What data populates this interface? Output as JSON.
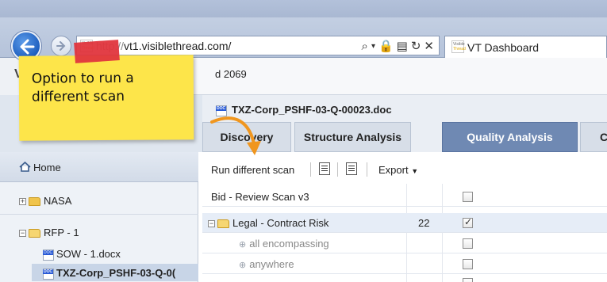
{
  "browser": {
    "url": "http://vt1.visiblethread.com/",
    "url_visible": "vt1.visiblethread.com/",
    "tab_title": "VT Dashboard",
    "favicon_text": [
      "Visible",
      "Thread"
    ]
  },
  "app": {
    "id_text": "d 2069",
    "brand_letter": "V"
  },
  "document": {
    "title": "TXZ-Corp_PSHF-03-Q-00023.doc"
  },
  "analysis_tabs": [
    {
      "label": "Discovery"
    },
    {
      "label": "Structure Analysis"
    },
    {
      "label": "Quality Analysis"
    },
    {
      "label": "C"
    }
  ],
  "sidebar": {
    "home_label": "Home",
    "tree": [
      {
        "label": "NASA",
        "expander": "+"
      },
      {
        "label": "RFP - 1",
        "expander": "−"
      },
      {
        "label": "SOW - 1.docx"
      },
      {
        "label": "TXZ-Corp_PSHF-03-Q-0("
      }
    ]
  },
  "toolbar": {
    "run_label": "Run different scan",
    "export_label": "Export"
  },
  "grid": {
    "rows": [
      {
        "label": "Bid - Review Scan v3",
        "count": "",
        "checked": false
      },
      {
        "label": "Legal - Contract Risk",
        "count": "22",
        "checked": true
      },
      {
        "label": "all encompassing",
        "count": "",
        "checked": false
      },
      {
        "label": "anywhere",
        "count": "",
        "checked": false
      }
    ]
  },
  "callout": {
    "line1": "Option to run a",
    "line2": "different scan"
  },
  "colors": {
    "active_tab": "#6f89b3",
    "sticky_note": "#fde54a",
    "tape": "#e0353d",
    "arrow": "#f0961e"
  }
}
